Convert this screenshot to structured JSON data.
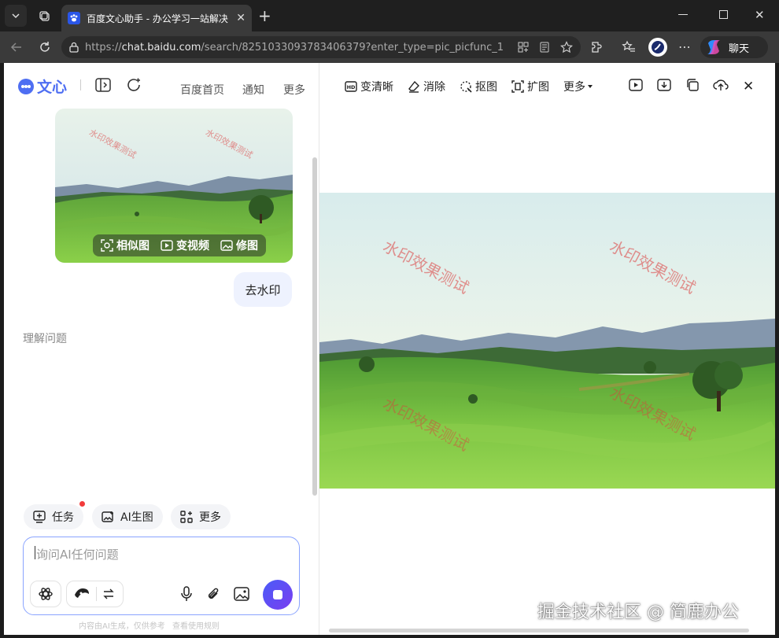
{
  "browser": {
    "tab_title": "百度文心助手 - 办公学习一站解决",
    "url_prefix": "https://",
    "url_host": "chat.baidu.com",
    "url_path": "/search/8251033093783406379?enter_type=pic_picfunc_1",
    "copilot_label": "聊天"
  },
  "left_panel": {
    "brand": "文心",
    "nav": [
      "百度首页",
      "通知",
      "更多"
    ],
    "image_actions": [
      "相似图",
      "变视频",
      "修图"
    ],
    "user_message": "去水印",
    "status_text": "理解问题",
    "quick_chips": [
      "任务",
      "AI生图",
      "更多"
    ],
    "input_placeholder": "询问AI任何问题",
    "disclaimer": "内容由AI生成，仅供参考",
    "disclaimer_link": "查看使用规则"
  },
  "right_panel": {
    "tools": [
      "变清晰",
      "消除",
      "抠图",
      "扩图",
      "更多"
    ]
  },
  "watermark_text": "水印效果测试",
  "page_watermark": "掘金技术社区 @ 简鹿办公",
  "colors": {
    "accent": "#4e6ef2",
    "send_button": "#5a3cf0",
    "watermark": "#dc3c3c"
  }
}
